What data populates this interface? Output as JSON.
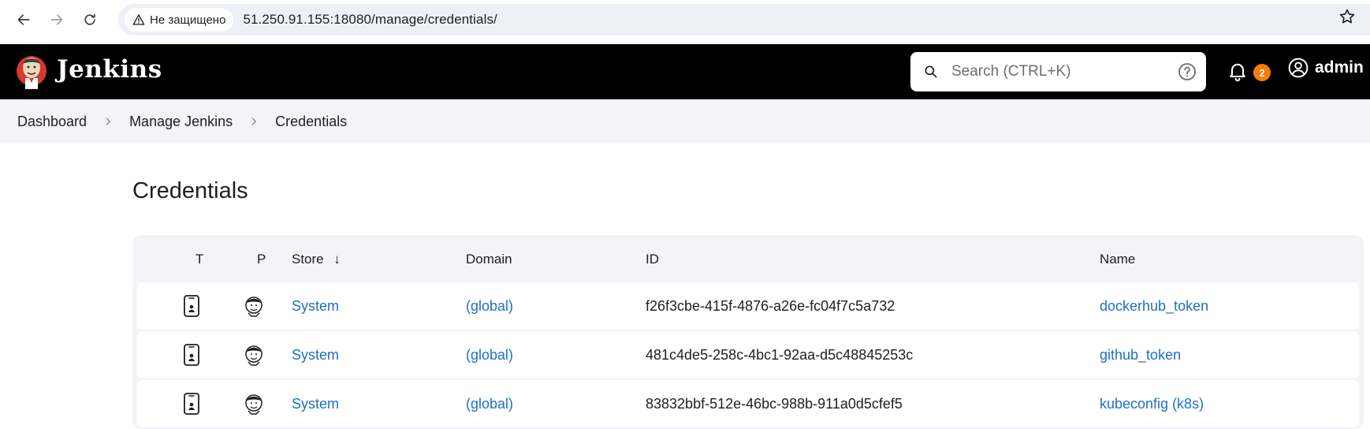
{
  "browser": {
    "security_label": "Не защищено",
    "url": "51.250.91.155:18080/manage/credentials/"
  },
  "header": {
    "title": "Jenkins",
    "search_placeholder": "Search (CTRL+K)",
    "notifications_count": "2",
    "user": "admin"
  },
  "breadcrumb": {
    "items": [
      "Dashboard",
      "Manage Jenkins",
      "Credentials"
    ]
  },
  "page": {
    "title": "Credentials"
  },
  "table": {
    "headers": {
      "t": "T",
      "p": "P",
      "store": "Store",
      "store_sort": "↓",
      "domain": "Domain",
      "id": "ID",
      "name": "Name"
    },
    "rows": [
      {
        "store": "System",
        "domain": "(global)",
        "id": "f26f3cbe-415f-4876-a26e-fc04f7c5a732",
        "name": "dockerhub_token"
      },
      {
        "store": "System",
        "domain": "(global)",
        "id": "481c4de5-258c-4bc1-92aa-d5c48845253c",
        "name": "github_token"
      },
      {
        "store": "System",
        "domain": "(global)",
        "id": "83832bbf-512e-46bc-988b-911a0d5cfef5",
        "name": "kubeconfig (k8s)"
      }
    ]
  },
  "colors": {
    "header_bg": "#000000",
    "link": "#1f6fc5",
    "badge": "#ff7a00",
    "breadcrumb_bg": "#f3f3f8"
  }
}
